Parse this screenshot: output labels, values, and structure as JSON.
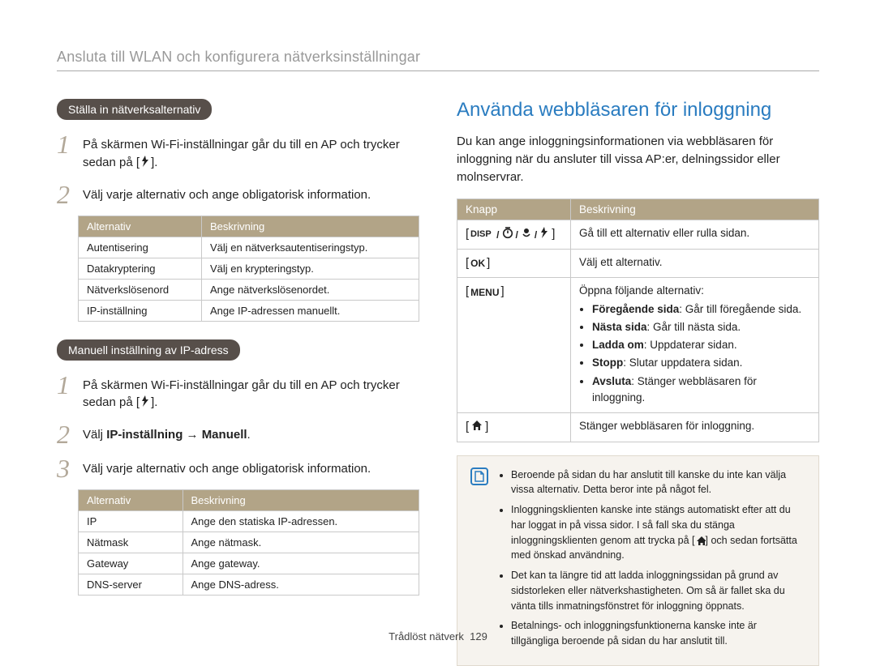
{
  "breadcrumb": "Ansluta till WLAN och konfigurera nätverksinställningar",
  "left": {
    "section1": {
      "heading": "Ställa in nätverksalternativ",
      "steps": [
        {
          "num": "1",
          "text_before": "På skärmen Wi-Fi-inställningar går du till en AP och trycker sedan på [",
          "icon": "flash-icon",
          "text_after": "]."
        },
        {
          "num": "2",
          "text_before": "Välj varje alternativ och ange obligatorisk information.",
          "icon": null,
          "text_after": ""
        }
      ],
      "table": {
        "headers": [
          "Alternativ",
          "Beskrivning"
        ],
        "rows": [
          [
            "Autentisering",
            "Välj en nätverksautentiseringstyp."
          ],
          [
            "Datakryptering",
            "Välj en krypteringstyp."
          ],
          [
            "Nätverkslösenord",
            "Ange nätverkslösenordet."
          ],
          [
            "IP-inställning",
            "Ange IP-adressen manuellt."
          ]
        ]
      }
    },
    "section2": {
      "heading": "Manuell inställning av IP-adress",
      "steps": [
        {
          "num": "1",
          "text_before": "På skärmen Wi-Fi-inställningar går du till en AP och trycker sedan på [",
          "icon": "flash-icon",
          "text_after": "]."
        },
        {
          "num": "2",
          "text_before": "Välj ",
          "bold": "IP-inställning → Manuell",
          "text_after": "."
        },
        {
          "num": "3",
          "text_before": "Välj varje alternativ och ange obligatorisk information.",
          "icon": null,
          "text_after": ""
        }
      ],
      "table": {
        "headers": [
          "Alternativ",
          "Beskrivning"
        ],
        "rows": [
          [
            "IP",
            "Ange den statiska IP-adressen."
          ],
          [
            "Nätmask",
            "Ange nätmask."
          ],
          [
            "Gateway",
            "Ange gateway."
          ],
          [
            "DNS-server",
            "Ange DNS-adress."
          ]
        ]
      }
    }
  },
  "right": {
    "title": "Använda webbläsaren för inloggning",
    "intro": "Du kan ange inloggningsinformationen via webbläsaren för inloggning när du ansluter till vissa AP:er, delningssidor eller molnservrar.",
    "buttons_table": {
      "headers": [
        "Knapp",
        "Beskrivning"
      ],
      "rows": [
        {
          "key_icons": [
            "disp-icon",
            "timer-icon",
            "macro-icon",
            "flash-icon"
          ],
          "key_text": "",
          "desc": "Gå till ett alternativ eller rulla sidan."
        },
        {
          "key_icons": [],
          "key_text": "OK",
          "desc": "Välj ett alternativ."
        },
        {
          "key_icons": [],
          "key_text": "MENU",
          "menu": {
            "intro": "Öppna följande alternativ:",
            "items": [
              {
                "label": "Föregående sida",
                "desc": ": Går till föregående sida."
              },
              {
                "label": "Nästa sida",
                "desc": ": Går till nästa sida."
              },
              {
                "label": "Ladda om",
                "desc": ": Uppdaterar sidan."
              },
              {
                "label": "Stopp",
                "desc": ": Slutar uppdatera sidan."
              },
              {
                "label": "Avsluta",
                "desc": ": Stänger webbläsaren för inloggning."
              }
            ]
          }
        },
        {
          "key_icons": [
            "home-icon"
          ],
          "key_text": "",
          "desc": "Stänger webbläsaren för inloggning."
        }
      ]
    },
    "notes": [
      "Beroende på sidan du har anslutit till kanske du inte kan välja vissa alternativ. Detta beror inte på något fel.",
      "Inloggningsklienten kanske inte stängs automatiskt efter att du har loggat in på vissa sidor. I så fall ska du stänga inloggningsklienten genom att trycka på [HOME] och sedan fortsätta med önskad användning.",
      "Det kan ta längre tid att ladda inloggningssidan på grund av sidstorleken eller nätverkshastigheten. Om så är fallet ska du vänta tills inmatningsfönstret för inloggning öppnats.",
      "Betalnings- och inloggningsfunktionerna kanske inte är tillgängliga beroende på sidan du har anslutit till."
    ]
  },
  "footer": {
    "section": "Trådlöst nätverk",
    "page": "129"
  }
}
